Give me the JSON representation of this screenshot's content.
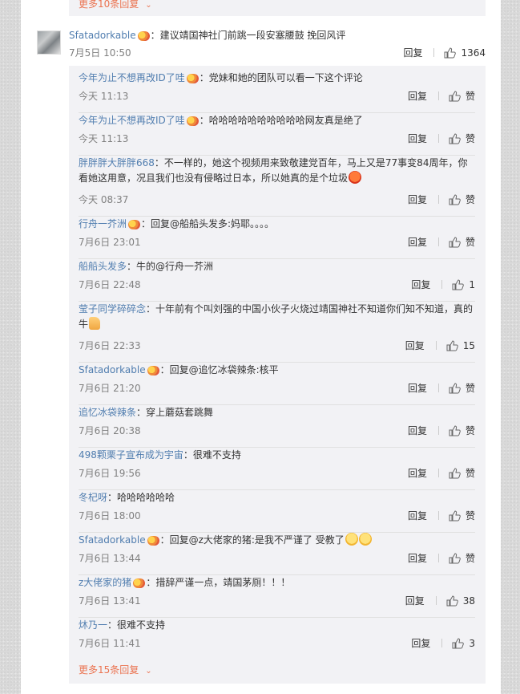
{
  "more_top": "更多10条回复",
  "more_bottom": "更多15条回复",
  "reply_label": "回复",
  "like_label": "赞",
  "main_comment": {
    "user": "Sfatadorkable",
    "text": "：建议靖国神社门前跳一段安塞腰鼓 挽回风评",
    "time": "7月5日 10:50",
    "likes": "1364"
  },
  "replies": [
    {
      "user": "今年为止不想再改ID了哇",
      "vip": true,
      "text": "：党妹和她的团队可以看一下这个评论",
      "time": "今天 11:13",
      "likes": ""
    },
    {
      "user": "今年为止不想再改ID了哇",
      "vip": true,
      "text": "：哈哈哈哈哈哈哈哈哈哈网友真是绝了",
      "time": "今天 11:13",
      "likes": ""
    },
    {
      "user": "胖胖胖大胖胖668",
      "vip": false,
      "text": "：不一样的，她这个视频用来致敬建党百年，马上又是77事变84周年，你看她这用意，况且我们也没有侵略过日本，所以她真的是个垃圾",
      "time": "今天 08:37",
      "likes": "",
      "emoji": "angry"
    },
    {
      "user": "行舟一芥洲",
      "vip": true,
      "text": "：回复@船船头发多:妈耶。。。。",
      "time": "7月6日 23:01",
      "likes": ""
    },
    {
      "user": "船船头发多",
      "vip": false,
      "text": "：牛的@行舟一芥洲",
      "time": "7月6日 22:48",
      "likes": "1"
    },
    {
      "user": "莹子同学碎碎念",
      "vip": false,
      "text": "：十年前有个叫刘强的中国小伙子火烧过靖国神社不知道你们知不知道，真的牛",
      "time": "7月6日 22:33",
      "likes": "15",
      "emoji": "thumbs"
    },
    {
      "user": "Sfatadorkable",
      "vip": true,
      "text": "：回复@追忆冰袋辣条:核平",
      "time": "7月6日 21:20",
      "likes": ""
    },
    {
      "user": "追忆冰袋辣条",
      "vip": false,
      "text": "：穿上蘑菇套跳舞",
      "time": "7月6日 20:38",
      "likes": ""
    },
    {
      "user": "498颗栗子宣布成为宇宙",
      "vip": false,
      "text": "：很难不支持",
      "time": "7月6日 19:56",
      "likes": ""
    },
    {
      "user": "冬杞呀",
      "vip": false,
      "text": "：哈哈哈哈哈哈",
      "time": "7月6日 18:00",
      "likes": ""
    },
    {
      "user": "Sfatadorkable",
      "vip": true,
      "text": "：回复@z大佬家的猪:是我不严谨了 受教了",
      "time": "7月6日 13:44",
      "likes": "",
      "emoji": "yellow2"
    },
    {
      "user": "z大佬家的猪",
      "vip": true,
      "text": "：措辞严谨一点，靖国茅厕！！！",
      "time": "7月6日 13:41",
      "likes": "38"
    },
    {
      "user": "炑乃一",
      "vip": false,
      "text": "：很难不支持",
      "time": "7月6日 11:41",
      "likes": "3"
    }
  ],
  "colors": {
    "link": "#eb7350",
    "username": "#507daf",
    "meta": "#808080",
    "subbox": "#f2f2f5"
  },
  "icons": [
    "thumb-up-icon",
    "chevron-down-icon",
    "vip-badge-icon",
    "angry-emoji-icon",
    "thumbs-up-emoji-icon",
    "smile-emoji-icon"
  ]
}
